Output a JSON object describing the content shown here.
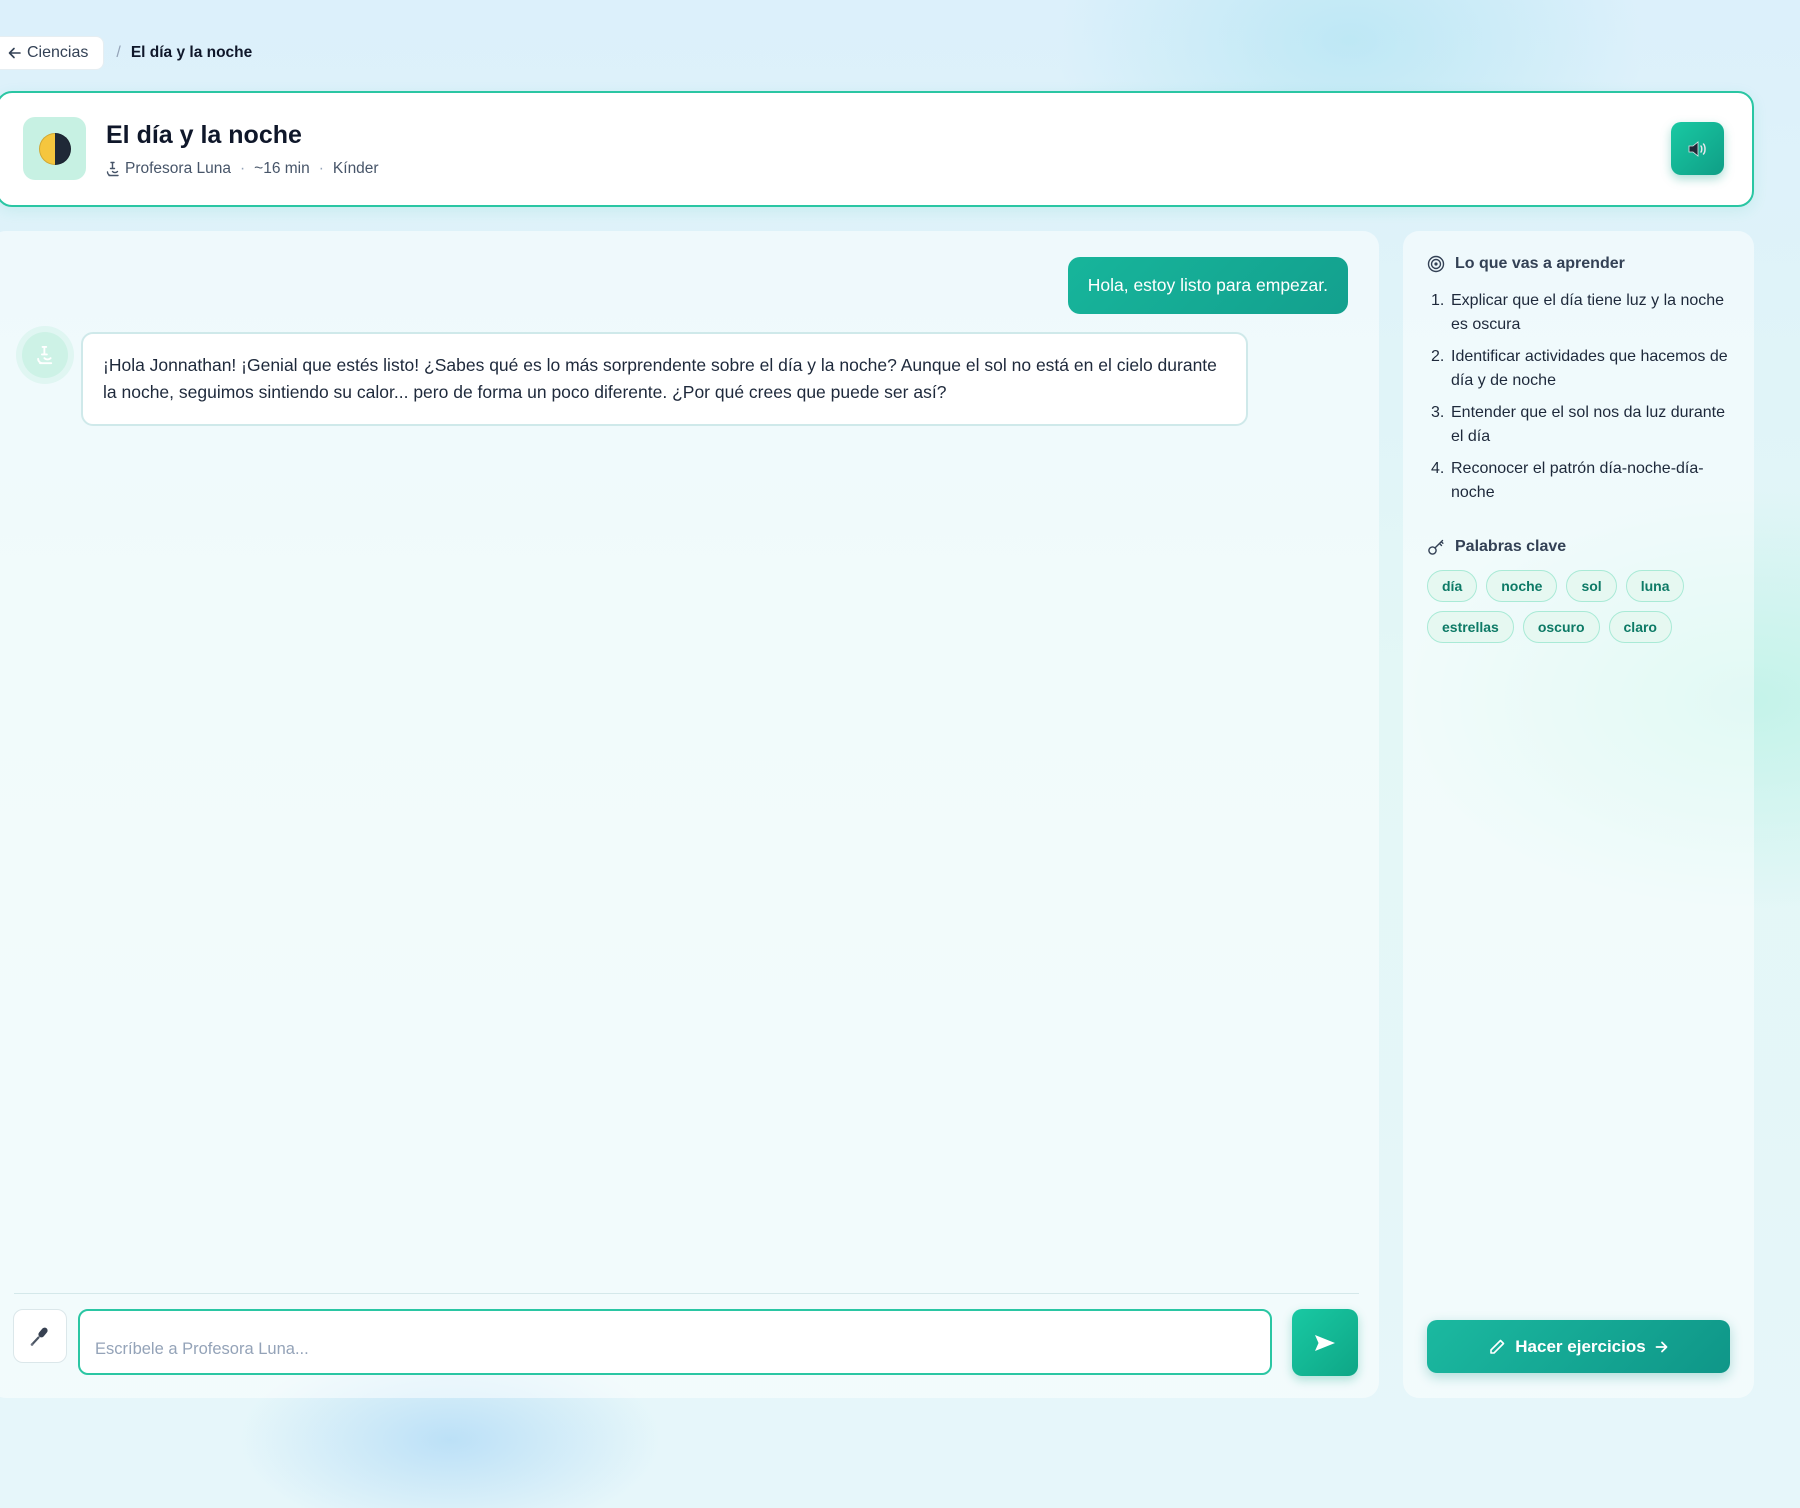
{
  "breadcrumb": {
    "back_label": "Ciencias",
    "separator": "/",
    "current": "El día y la noche"
  },
  "lesson": {
    "title": "El día y la noche",
    "teacher": "Profesora Luna",
    "duration": "~16 min",
    "level": "Kínder",
    "meta_separator": "·",
    "icon": "half-moon-icon"
  },
  "chat": {
    "messages": [
      {
        "role": "user",
        "text": "Hola, estoy listo para empezar."
      },
      {
        "role": "assistant",
        "text": "¡Hola Jonnathan! ¡Genial que estés listo! ¿Sabes qué es lo más sorprendente sobre el día y la noche? Aunque el sol no está en el cielo durante la noche, seguimos sintiendo su calor... pero de forma un poco diferente. ¿Por qué crees que puede ser así?"
      }
    ],
    "input_placeholder": "Escríbele a Profesora Luna..."
  },
  "sidebar": {
    "goals_heading": "Lo que vas a aprender",
    "goals": [
      {
        "num": "1.",
        "text": "Explicar que el día tiene luz y la noche es oscura"
      },
      {
        "num": "2.",
        "text": "Identificar actividades que hacemos de día y de noche"
      },
      {
        "num": "3.",
        "text": "Entender que el sol nos da luz durante el día"
      },
      {
        "num": "4.",
        "text": "Reconocer el patrón día-noche-día-noche"
      }
    ],
    "keywords_heading": "Palabras clave",
    "keywords": [
      "día",
      "noche",
      "sol",
      "luna",
      "estrellas",
      "oscuro",
      "claro"
    ],
    "exercise_button": "Hacer ejercicios"
  },
  "colors": {
    "accent": "#2ac6a3",
    "accent_dark": "#0f9688",
    "chip_text": "#0d7a66"
  }
}
